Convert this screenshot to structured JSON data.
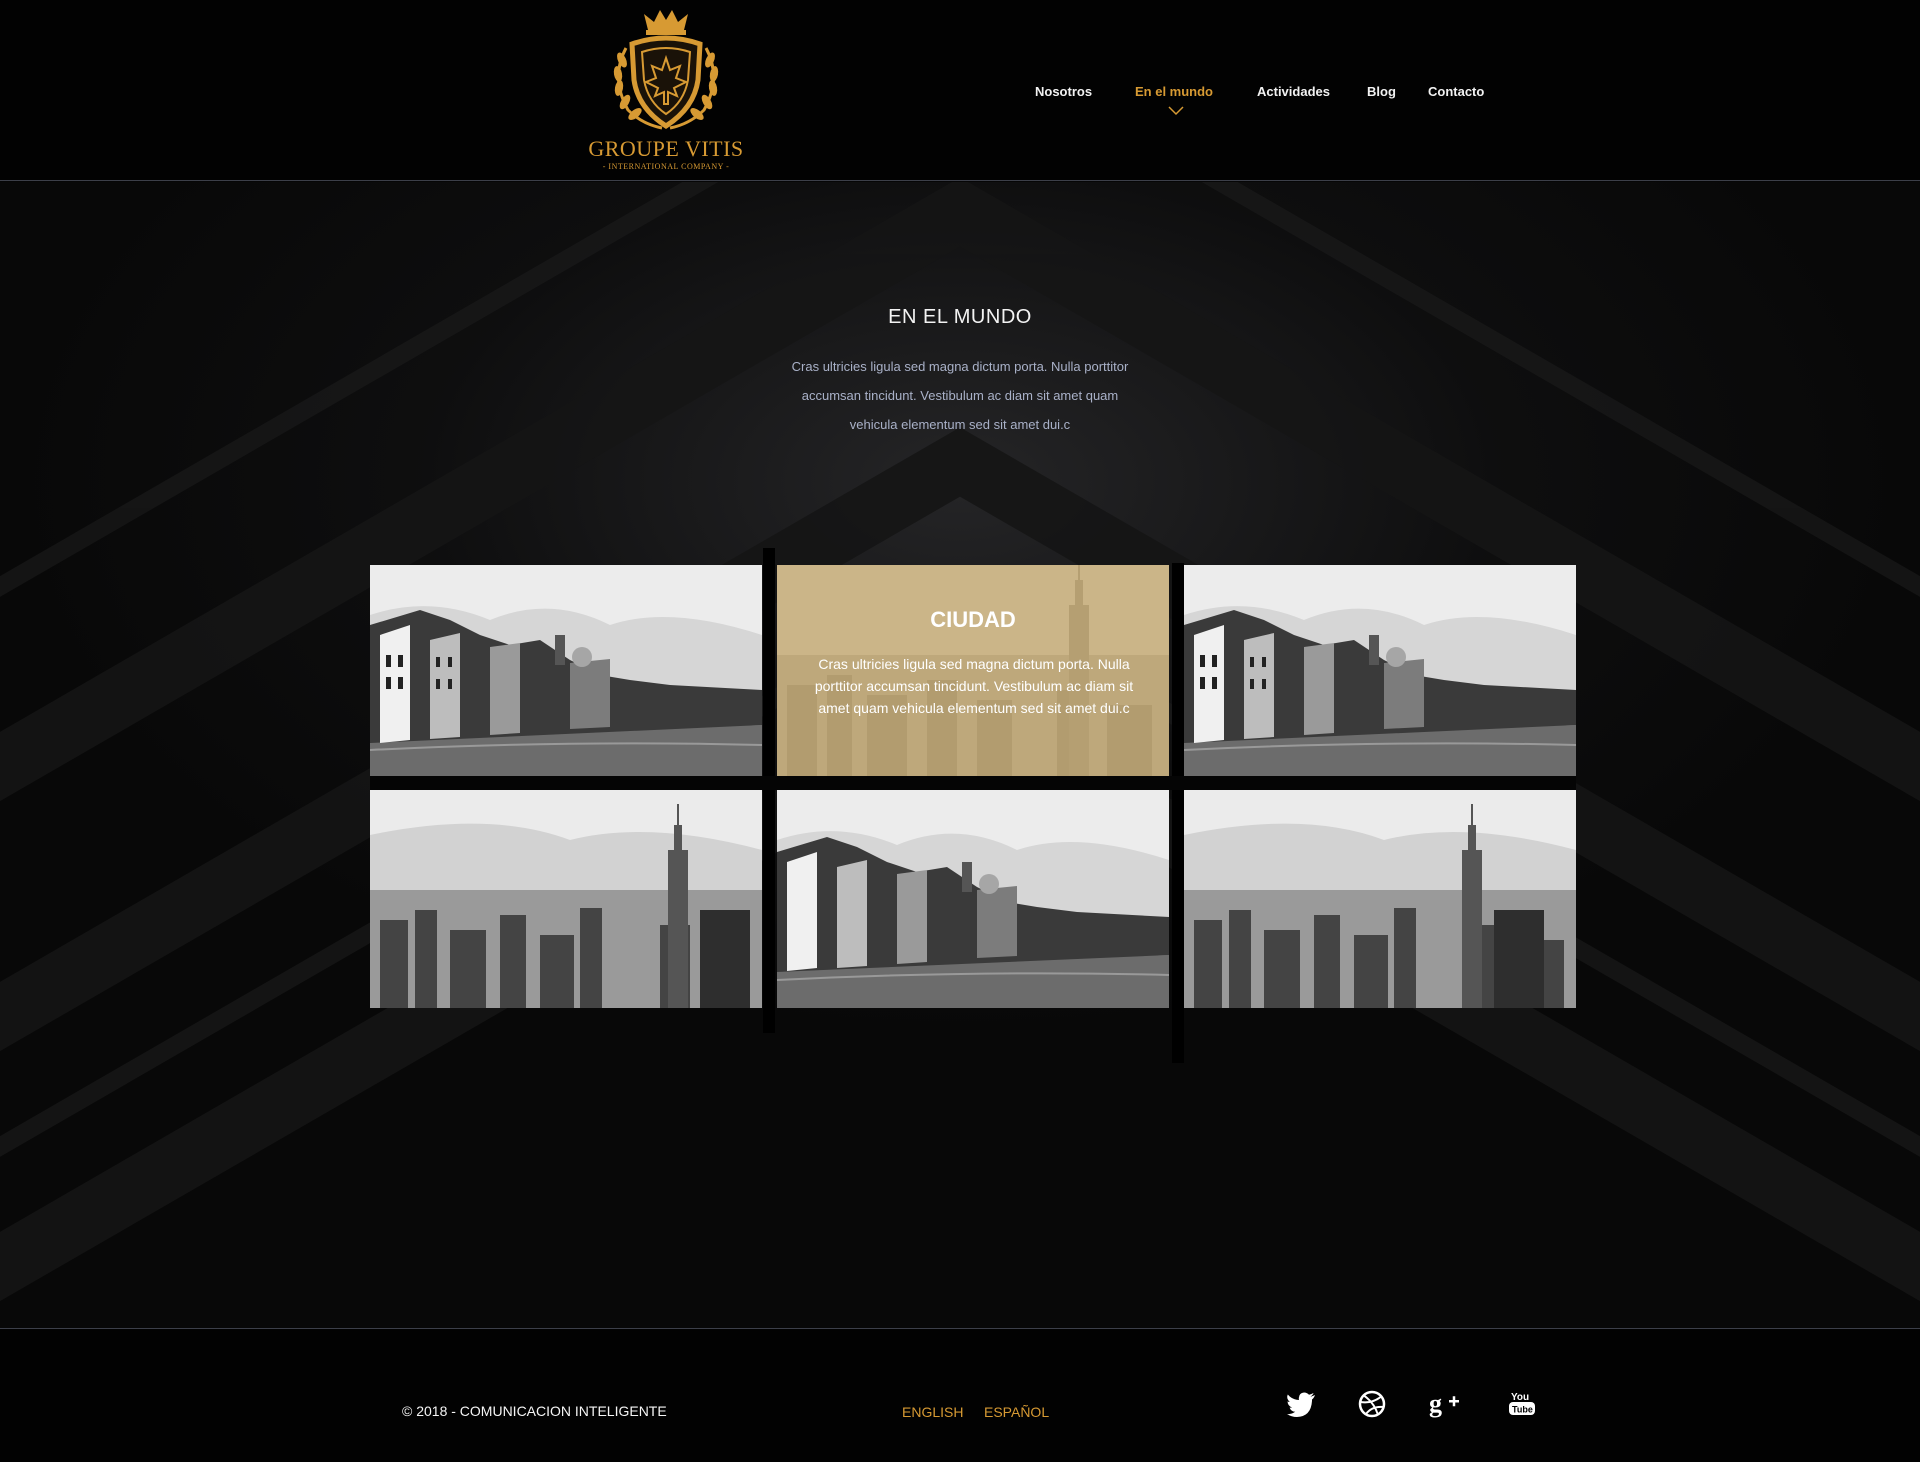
{
  "brand": {
    "name": "GROUPE VITIS",
    "tagline": "- INTERNATIONAL COMPANY -",
    "accent_color": "#d79a33"
  },
  "nav": {
    "items": [
      {
        "label": "Nosotros"
      },
      {
        "label": "En el mundo",
        "active": true
      },
      {
        "label": "Actividades"
      },
      {
        "label": "Blog"
      },
      {
        "label": "Contacto"
      }
    ]
  },
  "section": {
    "title": "EN EL MUNDO",
    "description": "Cras ultricies ligula sed magna dictum porta. Nulla porttitor accumsan tincidunt. Vestibulum ac diam sit amet quam vehicula elementum sed sit amet dui.c"
  },
  "gallery": {
    "tiles": [
      {
        "image": "venice-canal-photo"
      },
      {
        "image": "new-york-skyline-photo",
        "highlighted": true,
        "overlay_title": "CIUDAD",
        "overlay_text": "Cras ultricies ligula sed magna dictum porta. Nulla porttitor accumsan tincidunt. Vestibulum ac diam sit amet quam vehicula elementum sed sit amet dui.c"
      },
      {
        "image": "venice-canal-photo"
      },
      {
        "image": "new-york-skyline-photo"
      },
      {
        "image": "venice-canal-photo"
      },
      {
        "image": "new-york-skyline-photo"
      }
    ],
    "overlay_color": "#c9ae78"
  },
  "footer": {
    "copyright": "© 2018 - COMUNICACION INTELIGENTE",
    "languages": [
      "ENGLISH",
      "ESPAÑOL"
    ],
    "social": [
      "twitter-icon",
      "dribbble-icon",
      "google-plus-icon",
      "youtube-icon"
    ]
  }
}
